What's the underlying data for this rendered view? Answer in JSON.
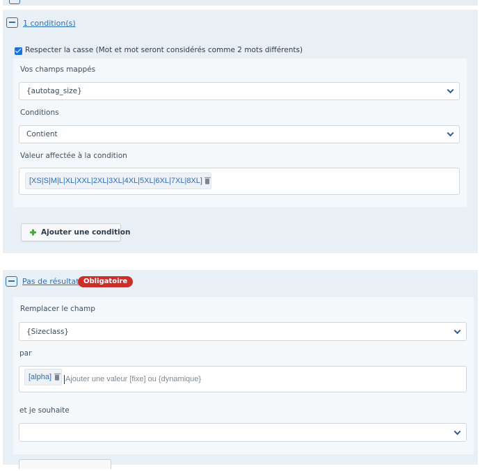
{
  "condition_block": {
    "toggle_link": "1 condition(s)",
    "case_checkbox": {
      "label": "Respecter la casse (Mot et mot seront considérés comme 2 mots différents)",
      "checked": true
    },
    "mapped_fields": {
      "label": "Vos champs mappés",
      "value": "{autotag_size}"
    },
    "conditions": {
      "label": "Conditions",
      "value": "Contient"
    },
    "assigned_value": {
      "label": "Valeur affectée à la condition",
      "tag": "[XS|S|M|L|XL|XXL|2XL|3XL|4XL|5XL|6XL|7XL|8XL]"
    },
    "add_button": "Ajouter une condition"
  },
  "no_results_block": {
    "toggle_link": "Pas de résultats",
    "badge": "Obligatoire",
    "replace_field": {
      "label": "Remplacer le champ",
      "value": "{Sizeclass}"
    },
    "par": {
      "label": "par",
      "tag": "[alpha]",
      "placeholder": "Ajouter une valeur [fixe] ou {dynamique}"
    },
    "wish": {
      "label": "et je souhaite",
      "value": ""
    }
  },
  "colors": {
    "panel_bg": "#e8eff5",
    "link": "#2c6fb0",
    "badge_bg": "#c9302c",
    "checkbox": "#1a73d9",
    "plus_icon": "#4aa63a"
  }
}
